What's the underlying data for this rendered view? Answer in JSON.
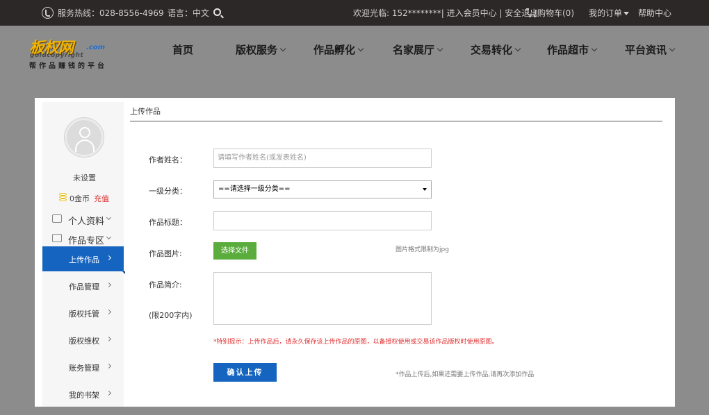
{
  "topbar": {
    "hotline": "服务热线：028-8556-4969",
    "language": "语言：中文",
    "welcome": "欢迎光临: 152********| 进入会员中心 | 安全退出",
    "cart": "购物车(0)",
    "my_orders": "我的订单",
    "help": "帮助中心"
  },
  "logo": {
    "main": "板权网",
    "com": ".com",
    "english": "goldcopyright",
    "slogan": "帮作品赚钱的平台"
  },
  "nav": {
    "items": [
      {
        "label": "首页"
      },
      {
        "label": "版权服务"
      },
      {
        "label": "作品孵化"
      },
      {
        "label": "名家展厅"
      },
      {
        "label": "交易转化"
      },
      {
        "label": "作品超市"
      },
      {
        "label": "平台资讯"
      }
    ]
  },
  "sidebar": {
    "username": "未设置",
    "coins": "0金币",
    "recharge": "充值",
    "profile": "个人资料",
    "works_zone": "作品专区",
    "items": [
      {
        "label": "上传作品"
      },
      {
        "label": "作品管理"
      },
      {
        "label": "版权托管"
      },
      {
        "label": "版权维权"
      },
      {
        "label": "账务管理"
      },
      {
        "label": "我的书架"
      }
    ]
  },
  "form": {
    "title": "上传作品",
    "author_label": "作者姓名：",
    "author_placeholder": "请填写作者姓名(或发表姓名)",
    "category_label": "一级分类：",
    "category_value": "==请选择一级分类==",
    "work_title_label": "作品标题：",
    "image_label": "作品图片:",
    "file_button": "选择文件",
    "image_hint": "图片格式限制为jpg",
    "intro_label": "作品简介:",
    "intro_limit": "(限200字内)",
    "warning": "*特别提示：上传作品后，请永久保存该上传作品的原图，以备授权使用或交易该作品版权时使用原图。",
    "submit": "确认上传",
    "submit_hint": "*作品上传后,如果还需要上传作品,请再次添加作品"
  },
  "colors": {
    "accent": "#1565c0",
    "topbar_bg": "#2d2828",
    "file_button": "#5aad3c",
    "warning": "#e03030"
  }
}
